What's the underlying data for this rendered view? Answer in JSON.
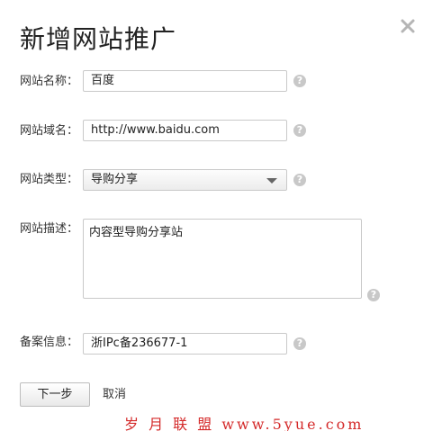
{
  "dialog": {
    "title": "新增网站推广",
    "close_icon": "close-icon"
  },
  "form": {
    "site_name": {
      "label": "网站名称：",
      "value": "百度"
    },
    "site_domain": {
      "label": "网站域名：",
      "value": "http://www.baidu.com"
    },
    "site_type": {
      "label": "网站类型：",
      "value": "导购分享"
    },
    "site_desc": {
      "label": "网站描述：",
      "value": "内容型导购分享站"
    },
    "icp": {
      "label": "备案信息：",
      "value": "浙IPc备236677-1"
    },
    "help_glyph": "?"
  },
  "actions": {
    "next_label": "下一步",
    "cancel_label": "取消"
  },
  "watermark": "岁 月 联 盟 www.5yue.com",
  "colors": {
    "border": "#c9c9c9",
    "help_icon": "#c8c8c8",
    "watermark": "#d42a2a"
  }
}
